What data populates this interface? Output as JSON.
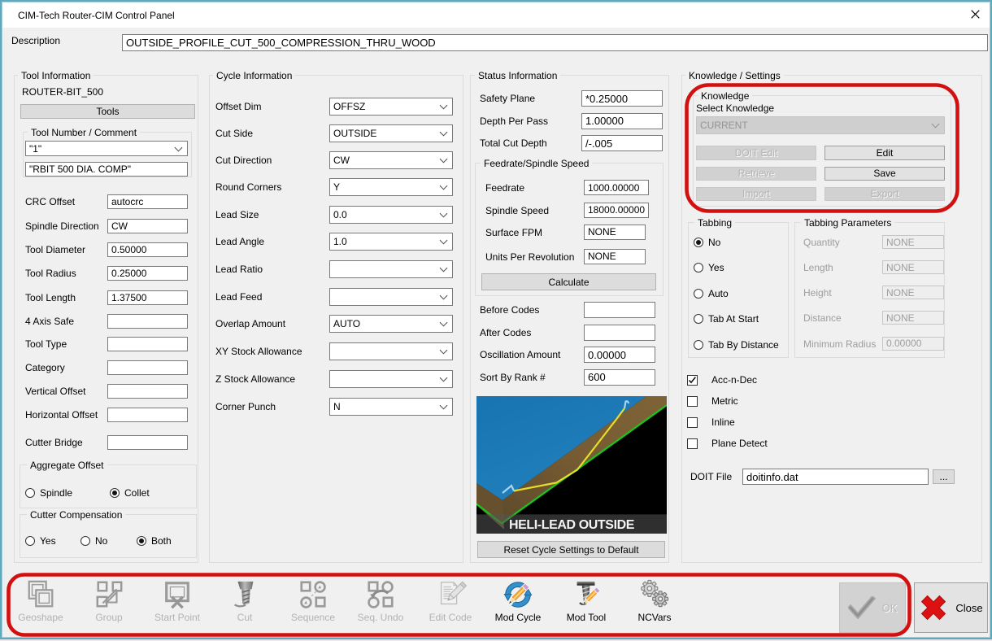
{
  "window": {
    "title": "CIM-Tech Router-CIM Control Panel"
  },
  "description": {
    "label": "Description",
    "value": "OUTSIDE_PROFILE_CUT_500_COMPRESSION_THRU_WOOD"
  },
  "tool": {
    "group_label": "Tool Information",
    "tool_name": "ROUTER-BIT_500",
    "tools_button": "Tools",
    "number_group_label": "Tool Number / Comment",
    "tool_number": "\"1\"",
    "tool_comment": "\"RBIT 500 DIA. COMP\"",
    "rows": [
      {
        "label": "CRC Offset",
        "value": "autocrc"
      },
      {
        "label": "Spindle Direction",
        "value": "CW"
      },
      {
        "label": "Tool Diameter",
        "value": "0.50000"
      },
      {
        "label": "Tool Radius",
        "value": "0.25000"
      },
      {
        "label": "Tool Length",
        "value": "1.37500"
      },
      {
        "label": "4 Axis Safe",
        "value": ""
      },
      {
        "label": "Tool Type",
        "value": ""
      },
      {
        "label": "Category",
        "value": ""
      },
      {
        "label": "Vertical Offset",
        "value": ""
      },
      {
        "label": "Horizontal Offset",
        "value": ""
      },
      {
        "label": "Cutter Bridge",
        "value": ""
      }
    ],
    "aggregate_offset": {
      "label": "Aggregate Offset",
      "options": [
        {
          "label": "Spindle",
          "selected": false
        },
        {
          "label": "Collet",
          "selected": true
        }
      ]
    },
    "cutter_compensation": {
      "label": "Cutter Compensation",
      "options": [
        {
          "label": "Yes",
          "selected": false
        },
        {
          "label": "No",
          "selected": false
        },
        {
          "label": "Both",
          "selected": true
        }
      ]
    }
  },
  "cycle": {
    "group_label": "Cycle Information",
    "rows": [
      {
        "label": "Offset Dim",
        "value": "OFFSZ"
      },
      {
        "label": "Cut Side",
        "value": "OUTSIDE"
      },
      {
        "label": "Cut Direction",
        "value": "CW"
      },
      {
        "label": "Round Corners",
        "value": "Y"
      },
      {
        "label": "Lead Size",
        "value": "0.0"
      },
      {
        "label": "Lead Angle",
        "value": "1.0"
      },
      {
        "label": "Lead Ratio",
        "value": ""
      },
      {
        "label": "Lead Feed",
        "value": ""
      },
      {
        "label": "Overlap Amount",
        "value": "AUTO"
      },
      {
        "label": "XY Stock Allowance",
        "value": ""
      },
      {
        "label": "Z Stock Allowance",
        "value": ""
      },
      {
        "label": "Corner Punch",
        "value": "N"
      }
    ]
  },
  "status": {
    "group_label": "Status Information",
    "rows_top": [
      {
        "label": "Safety Plane",
        "value": "*0.25000"
      },
      {
        "label": "Depth Per Pass",
        "value": "1.00000"
      },
      {
        "label": "Total Cut Depth",
        "value": "/-.005"
      }
    ],
    "feedrate_group": {
      "label": "Feedrate/Spindle Speed",
      "rows": [
        {
          "label": "Feedrate",
          "value": "1000.00000"
        },
        {
          "label": "Spindle Speed",
          "value": "18000.00000"
        },
        {
          "label": "Surface FPM",
          "value": "NONE"
        },
        {
          "label": "Units Per Revolution",
          "value": "NONE"
        }
      ],
      "calculate_button": "Calculate"
    },
    "rows_bottom": [
      {
        "label": "Before Codes",
        "value": ""
      },
      {
        "label": "After Codes",
        "value": ""
      },
      {
        "label": "Oscillation Amount",
        "value": "0.00000"
      },
      {
        "label": "Sort By Rank #",
        "value": "600"
      }
    ],
    "preview_caption": "HELI-LEAD OUTSIDE",
    "reset_button": "Reset Cycle Settings to Default"
  },
  "knowledge": {
    "group_label": "Knowledge / Settings",
    "knowledge_box": {
      "label": "Knowledge",
      "select_label": "Select Knowledge",
      "selected_value": "CURRENT",
      "buttons": [
        {
          "label": "DOIT Edit",
          "disabled": true
        },
        {
          "label": "Edit",
          "disabled": false
        },
        {
          "label": "Retrieve",
          "disabled": true
        },
        {
          "label": "Save",
          "disabled": false
        },
        {
          "label": "Import",
          "disabled": true
        },
        {
          "label": "Export",
          "disabled": true
        }
      ]
    },
    "tabbing": {
      "label": "Tabbing",
      "options": [
        {
          "label": "No",
          "selected": true
        },
        {
          "label": "Yes",
          "selected": false
        },
        {
          "label": "Auto",
          "selected": false
        },
        {
          "label": "Tab At Start",
          "selected": false
        },
        {
          "label": "Tab By Distance",
          "selected": false
        }
      ]
    },
    "tabbing_parameters": {
      "label": "Tabbing Parameters",
      "rows": [
        {
          "label": "Quantity",
          "value": "NONE"
        },
        {
          "label": "Length",
          "value": "NONE"
        },
        {
          "label": "Height",
          "value": "NONE"
        },
        {
          "label": "Distance",
          "value": "NONE"
        },
        {
          "label": "Minimum Radius",
          "value": "0.00000"
        }
      ]
    },
    "checkboxes": [
      {
        "label": "Acc-n-Dec",
        "checked": true
      },
      {
        "label": "Metric",
        "checked": false
      },
      {
        "label": "Inline",
        "checked": false
      },
      {
        "label": "Plane Detect",
        "checked": false
      }
    ],
    "doit_file": {
      "label": "DOIT File",
      "value": "doitinfo.dat",
      "browse_button": "..."
    }
  },
  "toolbar": {
    "items": [
      {
        "label": "Geoshape",
        "icon": "geoshape-icon",
        "disabled": true
      },
      {
        "label": "Group",
        "icon": "group-icon",
        "disabled": true
      },
      {
        "label": "Start Point",
        "icon": "start-point-icon",
        "disabled": true
      },
      {
        "label": "Cut",
        "icon": "cut-icon",
        "disabled": true
      },
      {
        "label": "Sequence",
        "icon": "sequence-icon",
        "disabled": true
      },
      {
        "label": "Seq. Undo",
        "icon": "sequence-undo-icon",
        "disabled": true
      },
      {
        "label": "Edit Code",
        "icon": "edit-code-icon",
        "disabled": true
      },
      {
        "label": "Mod Cycle",
        "icon": "mod-cycle-icon",
        "disabled": false
      },
      {
        "label": "Mod Tool",
        "icon": "mod-tool-icon",
        "disabled": false
      },
      {
        "label": "NCVars",
        "icon": "ncvars-icon",
        "disabled": false
      }
    ],
    "ok_button": "OK",
    "close_button": "Close"
  },
  "annotations": {
    "color": "#d21010",
    "note": "red highlight around Knowledge box and bottom toolbar"
  }
}
